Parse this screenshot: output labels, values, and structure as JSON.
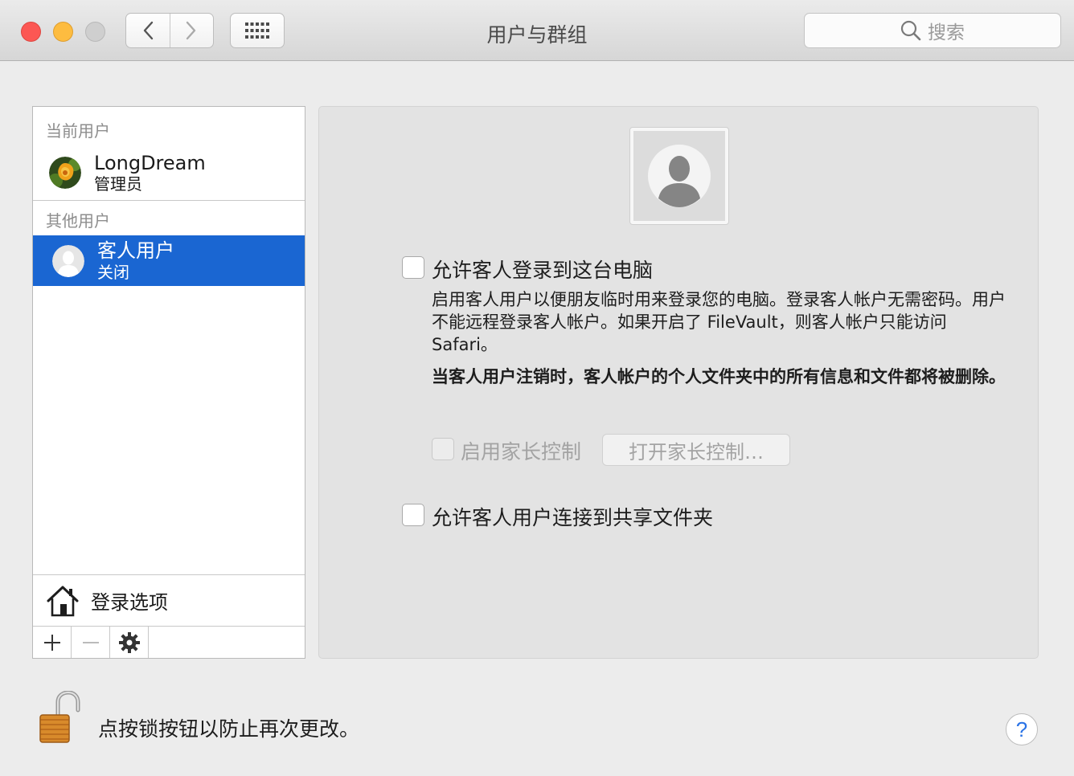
{
  "window": {
    "title": "用户与群组",
    "search_placeholder": "搜索"
  },
  "sidebar": {
    "current_section": "当前用户",
    "current_user": {
      "name": "LongDream",
      "role": "管理员"
    },
    "other_section": "其他用户",
    "guest_user": {
      "name": "客人用户",
      "status": "关闭"
    },
    "login_options": "登录选项"
  },
  "main": {
    "allow_guest_login": "允许客人登录到这台电脑",
    "description": "启用客人用户以便朋友临时用来登录您的电脑。登录客人帐户无需密码。用户不能远程登录客人帐户。如果开启了 FileVault，则客人帐户只能访问 Safari。",
    "warning": "当客人用户注销时，客人帐户的个人文件夹中的所有信息和文件都将被删除。",
    "parental_controls_label": "启用家长控制",
    "parental_controls_button": "打开家长控制…",
    "allow_shared_folders": "允许客人用户连接到共享文件夹"
  },
  "footer": {
    "lock_text": "点按锁按钮以防止再次更改。",
    "help": "?"
  },
  "colors": {
    "selection": "#1a66d2",
    "close": "#fc5753",
    "minimize": "#fdbc40"
  },
  "icons": [
    "back-chevron-icon",
    "forward-chevron-icon",
    "grid-icon",
    "search-icon",
    "house-icon",
    "plus-icon",
    "minus-icon",
    "gear-icon",
    "unlocked-padlock-icon"
  ]
}
